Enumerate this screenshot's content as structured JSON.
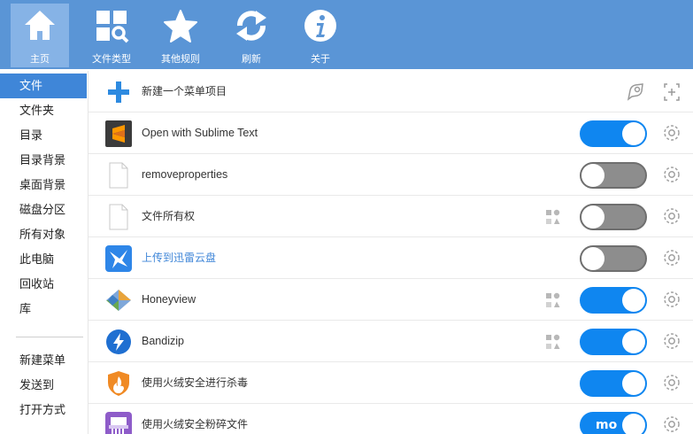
{
  "toolbar": {
    "buttons": [
      {
        "label": "主页",
        "icon": "home-icon",
        "active": true
      },
      {
        "label": "文件类型",
        "icon": "file-types-icon"
      },
      {
        "label": "其他规则",
        "icon": "star-icon"
      },
      {
        "label": "刷新",
        "icon": "refresh-icon"
      },
      {
        "label": "关于",
        "icon": "info-icon"
      }
    ]
  },
  "sidebar": {
    "items": [
      {
        "label": "文件",
        "active": true
      },
      {
        "label": "文件夹"
      },
      {
        "label": "目录"
      },
      {
        "label": "目录背景"
      },
      {
        "label": "桌面背景"
      },
      {
        "label": "磁盘分区"
      },
      {
        "label": "所有对象"
      },
      {
        "label": "此电脑"
      },
      {
        "label": "回收站"
      },
      {
        "label": "库"
      }
    ],
    "items_bottom": [
      {
        "label": "新建菜单"
      },
      {
        "label": "发送到"
      },
      {
        "label": "打开方式"
      }
    ]
  },
  "content": {
    "new_item_label": "新建一个菜单项目",
    "header_icons": [
      "dictionary-icon",
      "add-item-icon"
    ],
    "rows": [
      {
        "label": "Open with Sublime Text",
        "icon": "sublime-text-icon",
        "enabled": true,
        "badge": false
      },
      {
        "label": "removeproperties",
        "icon": "blank-file-icon",
        "enabled": false,
        "badge": false
      },
      {
        "label": "文件所有权",
        "icon": "blank-file-icon",
        "enabled": false,
        "badge": true
      },
      {
        "label": "上传到迅雷云盘",
        "icon": "thunder-cloud-icon",
        "enabled": false,
        "badge": false,
        "link": true
      },
      {
        "label": "Honeyview",
        "icon": "honeyview-icon",
        "enabled": true,
        "badge": true
      },
      {
        "label": "Bandizip",
        "icon": "bandizip-icon",
        "enabled": true,
        "badge": true
      },
      {
        "label": "使用火绒安全进行杀毒",
        "icon": "huorong-icon",
        "enabled": true,
        "badge": false
      },
      {
        "label": "使用火绒安全粉碎文件",
        "icon": "shredder-icon",
        "enabled": true,
        "badge": false,
        "toggle_text": "mo"
      }
    ]
  },
  "colors": {
    "toolbar_bg": "#5a95d6",
    "active_tab": "#86b3e6",
    "sidebar_active": "#3f86d8",
    "toggle_on": "#0f86f0",
    "toggle_off": "#8d8d8d",
    "link_text": "#3f86d8"
  }
}
